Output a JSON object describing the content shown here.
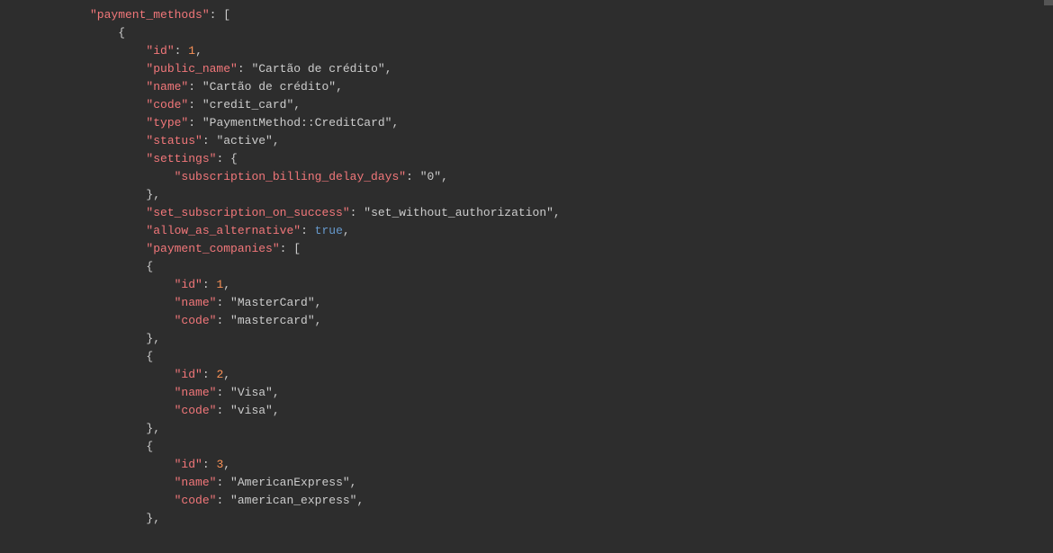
{
  "code": {
    "keys": {
      "payment_methods": "\"payment_methods\"",
      "id": "\"id\"",
      "public_name": "\"public_name\"",
      "name": "\"name\"",
      "code": "\"code\"",
      "type": "\"type\"",
      "status": "\"status\"",
      "settings": "\"settings\"",
      "subscription_billing_delay_days": "\"subscription_billing_delay_days\"",
      "set_subscription_on_success": "\"set_subscription_on_success\"",
      "allow_as_alternative": "\"allow_as_alternative\"",
      "payment_companies": "\"payment_companies\""
    },
    "values": {
      "id_1": "1",
      "id_2": "2",
      "id_3": "3",
      "cartao_de_credito": "\"Cartão de crédito\"",
      "credit_card": "\"credit_card\"",
      "payment_method_credit_card": "\"PaymentMethod::CreditCard\"",
      "active": "\"active\"",
      "zero": "\"0\"",
      "set_without_authorization": "\"set_without_authorization\"",
      "true_val": "true",
      "mastercard_name": "\"MasterCard\"",
      "mastercard_code": "\"mastercard\"",
      "visa_name": "\"Visa\"",
      "visa_code": "\"visa\"",
      "amex_name": "\"AmericanExpress\"",
      "amex_code": "\"american_express\""
    },
    "punct": {
      "colon_space": ": ",
      "colon_bracket": ": [",
      "colon_brace": ": {",
      "comma": ",",
      "open_brace": "{",
      "close_brace_comma": "},"
    }
  }
}
